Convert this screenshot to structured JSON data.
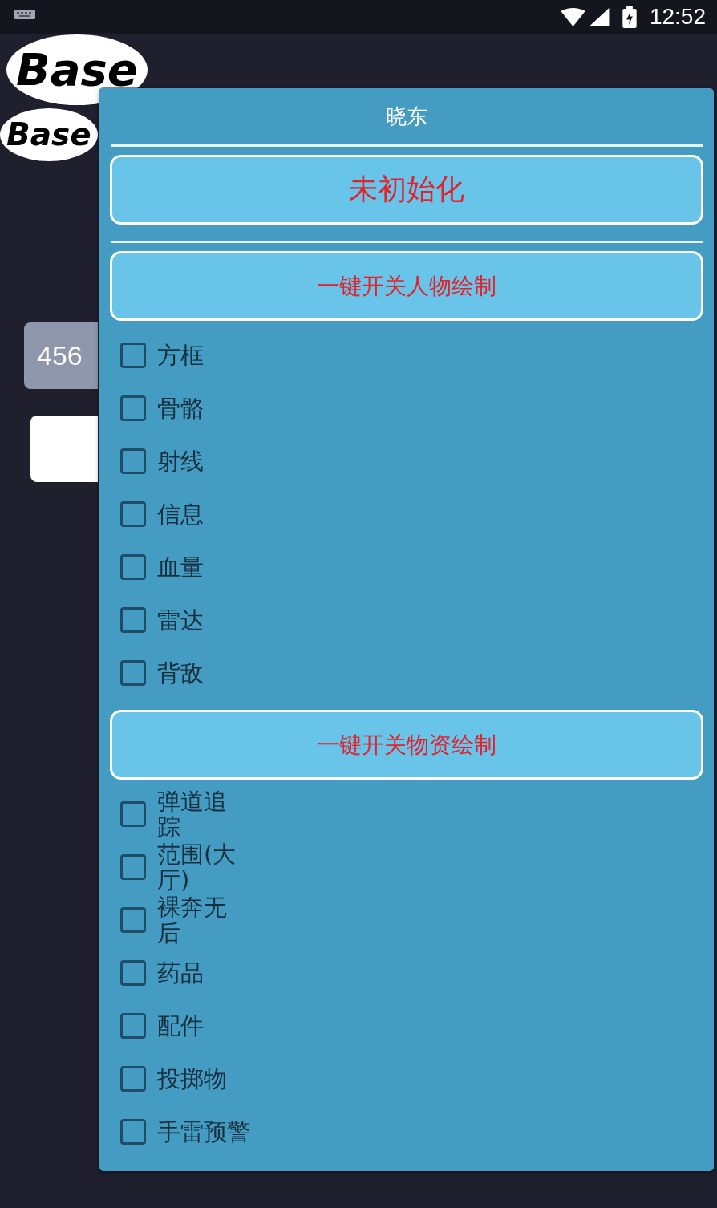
{
  "status_bar": {
    "time": "12:52"
  },
  "background": {
    "logos": [
      {
        "text": "Base",
        "kind": "large"
      },
      {
        "text": "Base",
        "kind": "small"
      }
    ],
    "input": {
      "value": "456"
    }
  },
  "dialog": {
    "title": "晓东",
    "status_button": {
      "label": "未初始化"
    },
    "sections": [
      {
        "toggle_button": {
          "label": "一键开关人物绘制"
        },
        "options": [
          {
            "label": "方框",
            "checked": false,
            "kind": "plain"
          },
          {
            "label": "骨骼",
            "checked": false,
            "kind": "plain"
          },
          {
            "label": "射线",
            "checked": false,
            "kind": "plain"
          },
          {
            "label": "信息",
            "checked": false,
            "kind": "plain"
          },
          {
            "label": "血量",
            "checked": false,
            "kind": "plain"
          },
          {
            "label": "雷达",
            "checked": false,
            "kind": "plain"
          },
          {
            "label": "背敌",
            "checked": false,
            "kind": "plain"
          }
        ]
      },
      {
        "toggle_button": {
          "label": "一键开关物资绘制"
        },
        "options": [
          {
            "label": "弹道追踪",
            "checked": false,
            "kind": "narrow"
          },
          {
            "label": "范围(大厅)",
            "checked": false,
            "kind": "narrow"
          },
          {
            "label": "裸奔无后",
            "checked": false,
            "kind": "narrow"
          },
          {
            "label": "药品",
            "checked": false,
            "kind": "plain"
          },
          {
            "label": "配件",
            "checked": false,
            "kind": "plain"
          },
          {
            "label": "投掷物",
            "checked": false,
            "kind": "plain"
          },
          {
            "label": "手雷预警",
            "checked": false,
            "kind": "plain"
          }
        ]
      }
    ]
  }
}
